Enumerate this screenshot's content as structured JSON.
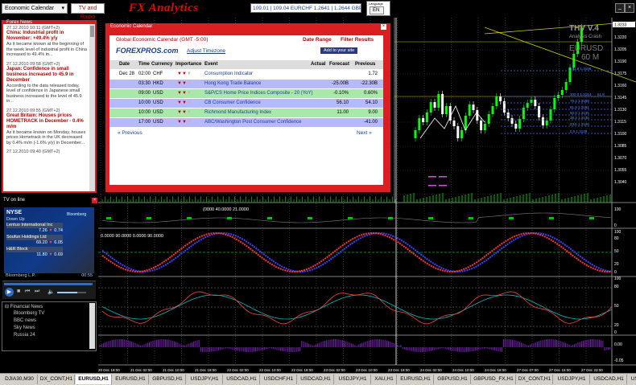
{
  "topbar": {
    "calendar_select": "Economic Calendar",
    "tv_radio_button": "TV and Radio",
    "logo": "FX Analytics",
    "ticker": "109.01 | 109.04 EURCHF 1.2641 | 1.2644 GBP",
    "lang": "EN",
    "lang_label": "Language"
  },
  "news": {
    "title": "Forex News",
    "items": [
      {
        "date": "27.12.2010 10:11 (GMT+2)",
        "head": "China: Industrial profit in November: +49.4% y/y",
        "body": "As it became known at the beginning of the week level of industrial profit in China increased to 49.4% in..."
      },
      {
        "date": "27.12.2010 09:58 (GMT+2)",
        "head": "Japan: Confidence in small business increased to 45.9 in December",
        "body": "According to the data released today, level of confidence in Japanese small business increased to the level of 45.9 in..."
      },
      {
        "date": "27.12.2010 09:55 (GMT+2)",
        "head": "Great Britain: Houses prices HOMETRACK in December - 0.4% m/m",
        "body": "As it became known on Monday, houses prices Hometrack in the UK decreased by 0.4% m/m (-1.6% y/y) in December..."
      },
      {
        "date": "27.12.2010 09:40 (GMT+2)",
        "head": "",
        "body": ""
      }
    ]
  },
  "econ": {
    "title": "Economic Calendar",
    "subtitle": "Global Economic Calendar (GMT -5:00)",
    "date_range": "Date Range",
    "filter": "Filter Results",
    "brand": "FOREXPROS.com",
    "adjust": "Adjust Timezone",
    "add_site": "Add to your site",
    "headers": {
      "date": "Date",
      "time": "Time",
      "currency": "Currency",
      "importance": "Importance",
      "event": "Event",
      "actual": "Actual",
      "forecast": "Forecast",
      "previous": "Previous"
    },
    "rows": [
      {
        "date": "Dec 28",
        "time": "02:00",
        "cur": "CHF",
        "event": "Consumption Indicator",
        "actual": "",
        "forecast": "",
        "previous": "1.72",
        "color": "#ffffff"
      },
      {
        "date": "",
        "time": "03:30",
        "cur": "HKD",
        "event": "Hong Kong Trade Balance",
        "actual": "",
        "forecast": "-25.00B",
        "previous": "-22.30B",
        "color": "#b8b8ff"
      },
      {
        "date": "",
        "time": "09:00",
        "cur": "USD",
        "event": "S&P/CS Home Price Indices Composite - 20 (YoY)",
        "actual": "",
        "forecast": "-0.10%",
        "previous": "0.60%",
        "color": "#a8e8a8"
      },
      {
        "date": "",
        "time": "10:00",
        "cur": "USD",
        "event": "CB Consumer Confidence",
        "actual": "",
        "forecast": "56.10",
        "previous": "54.10",
        "color": "#b8b8ff"
      },
      {
        "date": "",
        "time": "10:00",
        "cur": "USD",
        "event": "Richmond Manufacturing Index",
        "actual": "",
        "forecast": "11.00",
        "previous": "9.00",
        "color": "#a8e8a8"
      },
      {
        "date": "",
        "time": "17:00",
        "cur": "USD",
        "event": "ABC/Washington Post Consumer Confidence",
        "actual": "",
        "forecast": "",
        "previous": "-41.00",
        "color": "#b8b8ff"
      }
    ],
    "prev": "« Previous",
    "next": "Next »"
  },
  "tv": {
    "title": "TV on line",
    "exchange": "NYSE",
    "down_up": "Down Up",
    "quotes": [
      {
        "name": "Lentuo International Inc",
        "a": "7.26",
        "b": "0.74"
      },
      {
        "name": "Soufun Holdings Ltd",
        "a": "69.20",
        "b": "6.05"
      },
      {
        "name": "H&R Block",
        "a": "11.80",
        "b": "0.69"
      }
    ],
    "channel": "Bloomberg",
    "caption": "Bloomberg L.P.",
    "time": "00:55",
    "tree": {
      "root": "Financial News",
      "items": [
        "Bloomberg TV",
        "BBC news",
        "Sky News",
        "Russia 24"
      ]
    }
  },
  "chart": {
    "label_title": "THV V.4",
    "label_sub": "Analysis Crash",
    "symbol": "EURUSD",
    "timeframe": "60 M",
    "price_axis": [
      "1.3233",
      "1.3220",
      "1.3205",
      "1.3190",
      "1.3175",
      "1.3160",
      "1.3145",
      "1.3130",
      "1.3115",
      "1.3100",
      "1.3085",
      "1.3070",
      "1.3055",
      "1.3040"
    ],
    "price_current": "1.3233",
    "fib_labels": [
      "161.8 1.3196",
      "100.0 1.3164",
      "61.8",
      "76.4 1.3158",
      "61.8 1.3151",
      "50.0 1.3145",
      "38.2 1.3138",
      "23.6 1.3128",
      "0.0 1.3120"
    ],
    "ind1_label": "(0000 40.0000 21.0000",
    "ind2_label": "0.0000 90.0000  0.0000 90.0000",
    "ind_axis_1": [
      "100",
      "0"
    ],
    "ind_axis_2": [
      "100",
      "80",
      "50",
      "20",
      "0"
    ],
    "ind_axis_3": [
      "100",
      "80",
      "50",
      "20",
      "0"
    ],
    "ind_axis_4": [
      "0.00",
      "-0.05"
    ],
    "time_axis": [
      "17 Dec 2010",
      "20 Dec 02:00",
      "20 Dec 10:00",
      "20 Dec 18:00",
      "21 Dec 02:00",
      "21 Dec 10:00",
      "21 Dec 18:00",
      "22 Dec 02:00",
      "22 Dec 10:00",
      "22 Dec 18:00",
      "23 Dec 02:00",
      "23 Dec 10:00",
      "23 Dec 18:00",
      "24 Dec 02:00",
      "24 Dec 10:00",
      "24 Dec 18:00",
      "27 Dec 07:00",
      "27 Dec 15:00",
      "27 Dec 23:00"
    ]
  },
  "tabs": [
    "DJIA30,M30",
    "DX_CONT,H1",
    "EURUSD,H1",
    "EURUSD,H1",
    "GBPUSD,H1",
    "USDJPY,H1",
    "USDCAD,H1",
    "USDCHF,H1",
    "USDCAD,H1",
    "USDJPY,H1",
    "XAU,H1",
    "EURUSD,H1",
    "GBPUSD,H1",
    "GBPUSD_FX,H1",
    "DX_CONT,H1",
    "USDJPY,H1",
    "USDCAD,H1",
    "USDCHF,H1"
  ],
  "active_tab": 2,
  "colors": {
    "panel_red": "#d91f1f",
    "bull": "#00ff00",
    "bear": "#ff2020",
    "fib": "#3a6aff",
    "rsi_red": "#ff3030",
    "rsi_blue": "#4040ff"
  }
}
